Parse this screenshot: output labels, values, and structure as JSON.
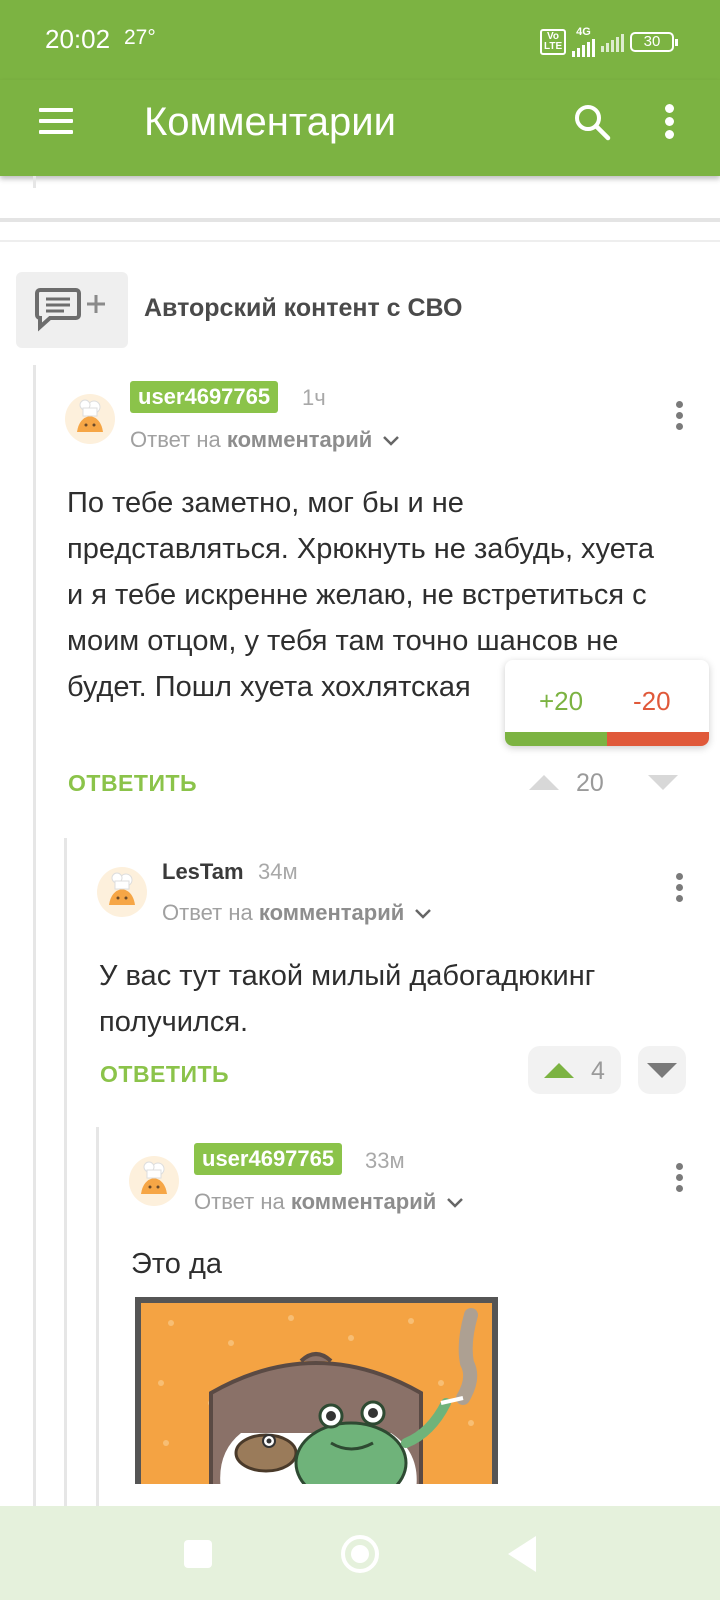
{
  "status": {
    "time": "20:02",
    "temp": "27°",
    "volte": "Vo LTE",
    "net": "4G",
    "battery": "30"
  },
  "appbar": {
    "title": "Комментарии"
  },
  "post": {
    "title": "Авторский контент с СВО"
  },
  "comments": [
    {
      "user": "user4697765",
      "time": "1ч",
      "reply_prefix": "Ответ на",
      "reply_target": "комментарий",
      "text": "По тебе заметно, мог бы и не представляться. Хрюкнуть не забудь, хуета и я тебе искренне желаю, не встретиться с моим отцом, у тебя там точно шансов не будет. Пошл хуета хохлятская",
      "reply_label": "ОТВЕТИТЬ",
      "rating": "20"
    },
    {
      "user": "LesTam",
      "time": "34м",
      "reply_prefix": "Ответ на",
      "reply_target": "комментарий",
      "text": "У вас тут такой милый дабогадюкинг получился.",
      "reply_label": "ОТВЕТИТЬ",
      "rating": "4"
    },
    {
      "user": "user4697765",
      "time": "33м",
      "reply_prefix": "Ответ на",
      "reply_target": "комментарий",
      "text": "Это да"
    }
  ],
  "vote_popup": {
    "plus": "+20",
    "minus": "-20",
    "plus_share": 0.5
  },
  "colors": {
    "accent": "#7cb342",
    "negative": "#e0593a"
  }
}
